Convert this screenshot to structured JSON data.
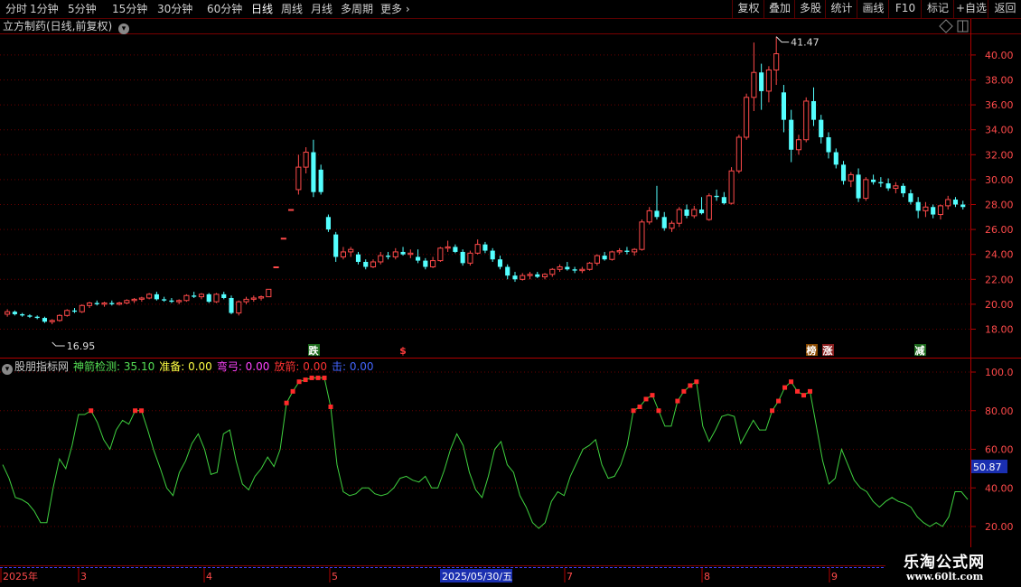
{
  "toolbar": {
    "periods": [
      "分时",
      "1分钟",
      "5分钟",
      "15分钟",
      "30分钟",
      "60分钟",
      "日线",
      "周线",
      "月线",
      "多周期",
      "更多"
    ],
    "active_period": "日线",
    "right_buttons": [
      "复权",
      "叠加",
      "多股",
      "统计",
      "画线",
      "F10",
      "标记",
      "+自选",
      "返回"
    ]
  },
  "stock_header": {
    "title": "立方制药(日线,前复权)"
  },
  "price_axis": {
    "ticks": [
      "40.00",
      "38.00",
      "36.00",
      "34.00",
      "32.00",
      "30.00",
      "28.00",
      "26.00",
      "24.00",
      "22.00",
      "20.00",
      "18.00"
    ]
  },
  "price_annotations": {
    "high": "41.47",
    "low": "16.95"
  },
  "signal_labels": [
    {
      "text": "跌",
      "color": "#ffffff",
      "bg": "#1d6a1d"
    },
    {
      "text": "$",
      "color": "#ff3b3b",
      "bg": ""
    },
    {
      "text": "榜",
      "color": "#ffffff",
      "bg": "#8a4a00"
    },
    {
      "text": "涨",
      "color": "#ffffff",
      "bg": "#8a1f1f"
    },
    {
      "text": "减",
      "color": "#ffffff",
      "bg": "#1d6a1d"
    }
  ],
  "indicator_header": {
    "name": "股朋指标网",
    "items": [
      {
        "label": "神箭检测: 35.10",
        "color": "#55e055"
      },
      {
        "label": "准备: 0.00",
        "color": "#ffff44"
      },
      {
        "label": "弯弓: 0.00",
        "color": "#ff44ff"
      },
      {
        "label": "放箭: 0.00",
        "color": "#ff3333"
      },
      {
        "label": "击: 0.00",
        "color": "#4466ff"
      }
    ]
  },
  "indicator_axis": {
    "ticks": [
      "100.0",
      "80.00",
      "60.00",
      "40.00",
      "20.00"
    ],
    "current_value": "50.87"
  },
  "date_axis": {
    "labels": [
      "2025年",
      "3",
      "4",
      "5",
      "7",
      "8",
      "9"
    ],
    "highlight": "2025/05/30/五"
  },
  "colors": {
    "up": "#ff4a4a",
    "down": "#54ffff",
    "grid": "#6a0000",
    "indicator_line": "#3fd13f",
    "signal_dot": "#ff2a2a"
  },
  "watermark": {
    "line1": "乐淘公式网",
    "line2": "www.60lt.com"
  },
  "chart_data": [
    {
      "type": "candlestick",
      "title": "立方制药(日线,前复权)",
      "ylim": [
        16.0,
        42.0
      ],
      "high_label": 41.47,
      "low_label": 16.95,
      "ohlc": [
        [
          19.2,
          19.6,
          19.0,
          19.4
        ],
        [
          19.4,
          19.5,
          19.1,
          19.2
        ],
        [
          19.2,
          19.3,
          19.0,
          19.1
        ],
        [
          19.1,
          19.2,
          18.9,
          19.0
        ],
        [
          19.0,
          19.1,
          18.8,
          18.9
        ],
        [
          18.9,
          19.0,
          18.5,
          18.6
        ],
        [
          18.6,
          18.8,
          18.4,
          18.7
        ],
        [
          18.7,
          19.2,
          18.6,
          19.1
        ],
        [
          19.1,
          19.6,
          19.0,
          19.5
        ],
        [
          19.5,
          19.7,
          19.3,
          19.4
        ],
        [
          19.4,
          20.0,
          19.3,
          19.9
        ],
        [
          19.9,
          20.2,
          19.7,
          20.1
        ],
        [
          20.1,
          20.3,
          19.9,
          20.0
        ],
        [
          20.0,
          20.2,
          19.8,
          20.1
        ],
        [
          20.1,
          20.3,
          19.9,
          20.0
        ],
        [
          20.0,
          20.2,
          19.9,
          20.1
        ],
        [
          20.1,
          20.4,
          20.0,
          20.3
        ],
        [
          20.3,
          20.5,
          20.1,
          20.4
        ],
        [
          20.4,
          20.6,
          20.2,
          20.5
        ],
        [
          20.5,
          20.9,
          20.4,
          20.8
        ],
        [
          20.8,
          21.0,
          20.3,
          20.4
        ],
        [
          20.4,
          20.6,
          20.2,
          20.3
        ],
        [
          20.3,
          20.5,
          20.1,
          20.2
        ],
        [
          20.2,
          20.4,
          20.0,
          20.3
        ],
        [
          20.3,
          20.8,
          20.2,
          20.7
        ],
        [
          20.7,
          21.0,
          20.5,
          20.6
        ],
        [
          20.6,
          20.9,
          20.4,
          20.8
        ],
        [
          20.8,
          20.9,
          20.1,
          20.2
        ],
        [
          20.2,
          20.9,
          20.1,
          20.8
        ],
        [
          20.8,
          21.0,
          20.4,
          20.5
        ],
        [
          20.5,
          20.7,
          19.2,
          19.3
        ],
        [
          19.3,
          20.3,
          19.1,
          20.2
        ],
        [
          20.2,
          20.6,
          20.0,
          20.4
        ],
        [
          20.4,
          20.7,
          20.2,
          20.5
        ],
        [
          20.5,
          20.7,
          20.3,
          20.6
        ],
        [
          20.6,
          21.2,
          20.6,
          21.2
        ],
        [
          23.0,
          23.0,
          23.0,
          23.0
        ],
        [
          25.3,
          25.3,
          25.3,
          25.3
        ],
        [
          27.6,
          27.6,
          27.6,
          27.6
        ],
        [
          29.2,
          32.0,
          28.8,
          31.0
        ],
        [
          31.0,
          32.6,
          30.5,
          32.2
        ],
        [
          32.2,
          33.2,
          28.6,
          29.0
        ],
        [
          30.8,
          31.2,
          28.8,
          29.0
        ],
        [
          27.0,
          27.2,
          25.8,
          26.0
        ],
        [
          25.6,
          25.8,
          23.4,
          23.8
        ],
        [
          23.8,
          24.6,
          23.6,
          24.2
        ],
        [
          24.2,
          24.6,
          23.8,
          24.4
        ],
        [
          24.0,
          24.2,
          23.2,
          23.4
        ],
        [
          23.4,
          23.6,
          22.8,
          23.0
        ],
        [
          23.0,
          23.6,
          22.9,
          23.4
        ],
        [
          23.4,
          24.2,
          23.2,
          23.9
        ],
        [
          23.9,
          24.2,
          23.6,
          23.8
        ],
        [
          23.8,
          24.5,
          23.6,
          24.2
        ],
        [
          24.2,
          24.6,
          23.9,
          24.0
        ],
        [
          24.0,
          24.4,
          23.7,
          24.1
        ],
        [
          23.8,
          24.4,
          23.3,
          23.5
        ],
        [
          23.5,
          23.7,
          22.8,
          23.0
        ],
        [
          23.0,
          23.8,
          22.9,
          23.5
        ],
        [
          23.5,
          24.6,
          23.4,
          24.5
        ],
        [
          24.5,
          25.1,
          24.2,
          24.6
        ],
        [
          24.6,
          24.8,
          24.1,
          24.2
        ],
        [
          24.2,
          24.4,
          23.1,
          23.3
        ],
        [
          23.3,
          24.3,
          23.1,
          24.1
        ],
        [
          24.1,
          25.2,
          24.0,
          24.8
        ],
        [
          24.8,
          25.0,
          24.1,
          24.3
        ],
        [
          24.3,
          24.5,
          23.4,
          23.6
        ],
        [
          23.6,
          23.9,
          22.8,
          23.0
        ],
        [
          23.0,
          23.2,
          22.0,
          22.3
        ],
        [
          22.3,
          22.6,
          21.8,
          22.0
        ],
        [
          22.0,
          22.5,
          21.9,
          22.3
        ],
        [
          22.3,
          22.6,
          22.0,
          22.4
        ],
        [
          22.4,
          22.6,
          22.1,
          22.2
        ],
        [
          22.2,
          22.5,
          22.0,
          22.4
        ],
        [
          22.4,
          22.9,
          22.2,
          22.8
        ],
        [
          22.8,
          23.2,
          22.6,
          23.0
        ],
        [
          23.0,
          23.4,
          22.7,
          22.8
        ],
        [
          22.8,
          23.0,
          22.5,
          22.7
        ],
        [
          22.7,
          23.0,
          22.5,
          22.8
        ],
        [
          22.8,
          23.4,
          22.7,
          23.3
        ],
        [
          23.3,
          24.0,
          23.1,
          23.9
        ],
        [
          23.9,
          24.2,
          23.5,
          23.6
        ],
        [
          23.6,
          24.3,
          23.5,
          24.2
        ],
        [
          24.2,
          24.5,
          24.0,
          24.3
        ],
        [
          24.3,
          24.6,
          24.0,
          24.2
        ],
        [
          24.2,
          24.5,
          23.9,
          24.4
        ],
        [
          24.4,
          26.8,
          24.3,
          26.6
        ],
        [
          26.6,
          27.8,
          26.4,
          27.5
        ],
        [
          27.5,
          29.5,
          26.8,
          27.0
        ],
        [
          27.0,
          27.4,
          25.9,
          26.1
        ],
        [
          26.1,
          26.7,
          25.8,
          26.5
        ],
        [
          26.5,
          27.8,
          26.2,
          27.6
        ],
        [
          27.6,
          28.0,
          26.9,
          27.1
        ],
        [
          27.1,
          27.9,
          26.9,
          27.6
        ],
        [
          27.6,
          28.6,
          27.2,
          27.3
        ],
        [
          26.8,
          28.9,
          26.7,
          28.7
        ],
        [
          28.7,
          29.2,
          28.3,
          28.6
        ],
        [
          28.6,
          29.0,
          28.0,
          28.1
        ],
        [
          28.1,
          31.0,
          28.0,
          30.7
        ],
        [
          30.7,
          33.6,
          30.5,
          33.4
        ],
        [
          33.4,
          36.9,
          33.2,
          36.6
        ],
        [
          36.6,
          41.0,
          35.5,
          38.6
        ],
        [
          38.6,
          39.3,
          35.6,
          37.1
        ],
        [
          37.1,
          39.1,
          36.2,
          38.8
        ],
        [
          38.8,
          41.47,
          37.6,
          40.1
        ],
        [
          37.0,
          37.6,
          33.8,
          34.8
        ],
        [
          34.8,
          35.6,
          31.4,
          32.4
        ],
        [
          32.4,
          33.6,
          32.0,
          33.2
        ],
        [
          33.2,
          36.6,
          33.0,
          36.3
        ],
        [
          36.3,
          37.4,
          34.3,
          34.8
        ],
        [
          34.8,
          35.2,
          32.9,
          33.4
        ],
        [
          33.4,
          33.8,
          31.7,
          32.2
        ],
        [
          32.2,
          32.5,
          30.9,
          31.2
        ],
        [
          31.2,
          31.5,
          29.6,
          29.9
        ],
        [
          29.9,
          30.6,
          29.4,
          30.4
        ],
        [
          30.4,
          30.9,
          28.2,
          28.5
        ],
        [
          28.5,
          30.2,
          28.3,
          30.0
        ],
        [
          30.0,
          30.4,
          29.6,
          29.8
        ],
        [
          29.8,
          30.2,
          29.4,
          29.7
        ],
        [
          29.7,
          30.1,
          29.1,
          29.3
        ],
        [
          29.3,
          29.8,
          28.9,
          29.5
        ],
        [
          29.5,
          29.7,
          28.6,
          28.9
        ],
        [
          28.9,
          29.2,
          28.0,
          28.2
        ],
        [
          28.2,
          28.6,
          26.9,
          27.5
        ],
        [
          27.5,
          28.2,
          27.0,
          27.8
        ],
        [
          27.8,
          28.0,
          26.9,
          27.2
        ],
        [
          27.2,
          28.0,
          26.8,
          27.9
        ],
        [
          27.9,
          28.7,
          27.6,
          28.4
        ],
        [
          28.4,
          28.6,
          27.8,
          28.0
        ],
        [
          28.0,
          28.3,
          27.6,
          27.8
        ]
      ]
    },
    {
      "type": "line",
      "title": "股朋指标网",
      "ylim": [
        10,
        105
      ],
      "series": [
        {
          "name": "神箭检测",
          "values": [
            52,
            45,
            35,
            34,
            32,
            28,
            22,
            22,
            40,
            55,
            50,
            62,
            78,
            78,
            80,
            74,
            65,
            60,
            70,
            75,
            73,
            80,
            80,
            70,
            59,
            50,
            40,
            36,
            48,
            54,
            63,
            68,
            60,
            47,
            48,
            68,
            70,
            54,
            42,
            39,
            46,
            50,
            56,
            51,
            60,
            84,
            90,
            95,
            96,
            97,
            97,
            97,
            82,
            52,
            38,
            36,
            37,
            40,
            40,
            37,
            36,
            37,
            40,
            45,
            46,
            44,
            43,
            46,
            40,
            40,
            49,
            60,
            68,
            62,
            48,
            39,
            35,
            46,
            60,
            64,
            52,
            48,
            36,
            30,
            22,
            19,
            22,
            33,
            38,
            36,
            46,
            53,
            60,
            62,
            65,
            52,
            45,
            46,
            52,
            62,
            80,
            82,
            86,
            88,
            80,
            72,
            72,
            85,
            90,
            93,
            95,
            72,
            64,
            70,
            77,
            78,
            77,
            63,
            69,
            75,
            70,
            70,
            80,
            85,
            92,
            95,
            90,
            88,
            90,
            72,
            54,
            42,
            45,
            60,
            52,
            44,
            40,
            38,
            33,
            30,
            33,
            35,
            33,
            32,
            30,
            25,
            22,
            20,
            22,
            20,
            25,
            38,
            38,
            34
          ]
        }
      ],
      "signal_points_shown": true
    }
  ]
}
